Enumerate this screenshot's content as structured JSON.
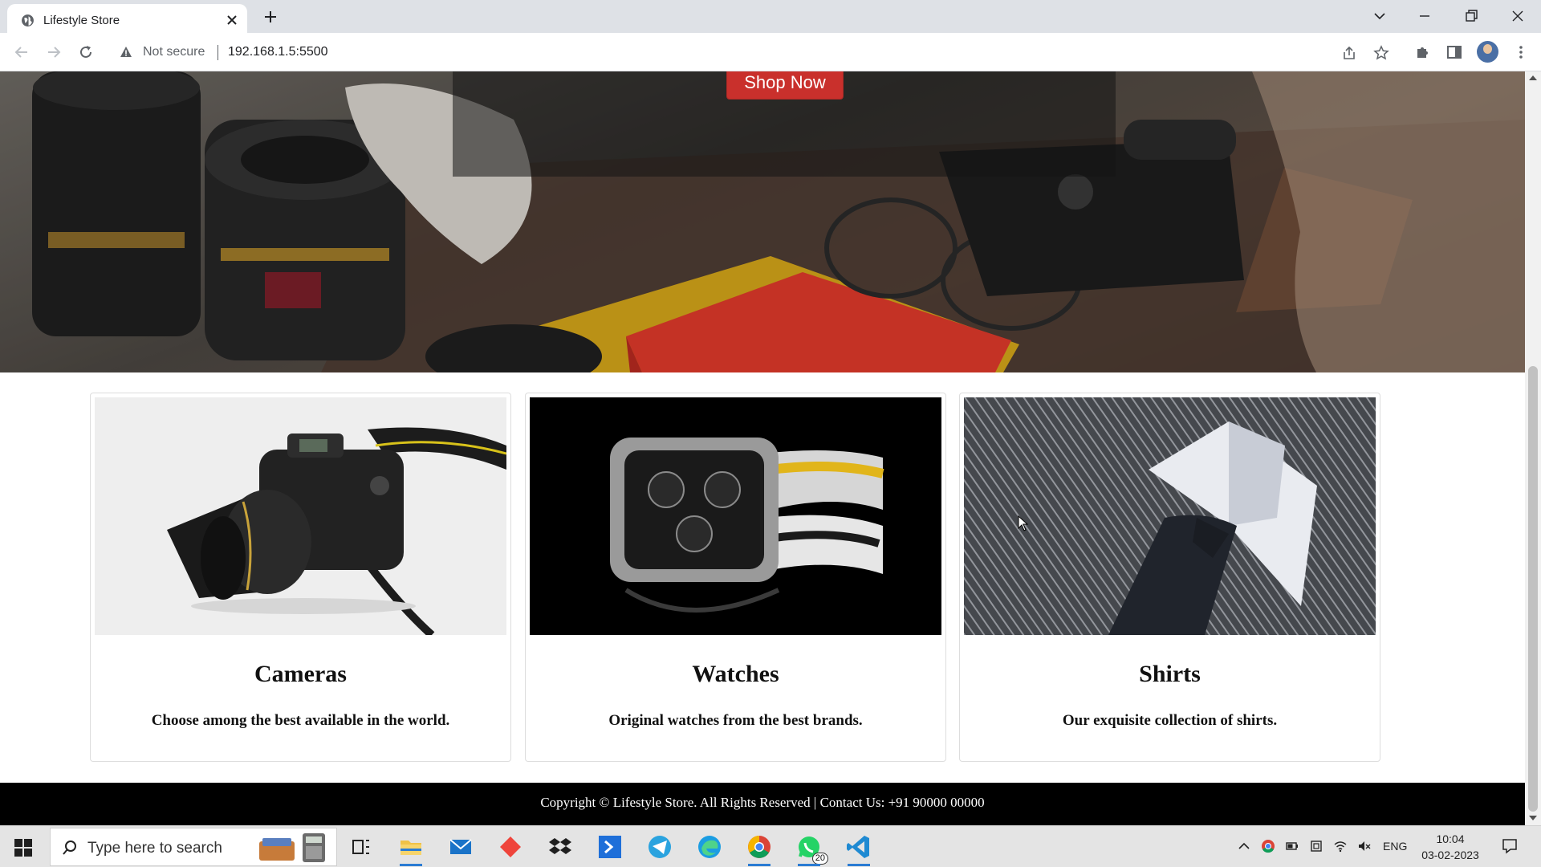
{
  "browser": {
    "tab_title": "Lifestyle Store",
    "security_label": "Not secure",
    "url": "192.168.1.5:5500"
  },
  "hero": {
    "button_label": "Shop Now"
  },
  "cards": [
    {
      "title": "Cameras",
      "text": "Choose among the best available in the world.",
      "image_icon": "camera-photo"
    },
    {
      "title": "Watches",
      "text": "Original watches from the best brands.",
      "image_icon": "watch-photo"
    },
    {
      "title": "Shirts",
      "text": "Our exquisite collection of shirts.",
      "image_icon": "shirt-photo"
    }
  ],
  "footer": {
    "text": "Copyright © Lifestyle Store. All Rights Reserved | Contact Us: +91 90000 00000"
  },
  "taskbar": {
    "search_placeholder": "Type here to search",
    "whatsapp_badge": "20",
    "language": "ENG",
    "time": "10:04",
    "date": "03-02-2023"
  },
  "colors": {
    "shop_button": "#c9302c",
    "footer_bg": "#000000",
    "tabbar_bg": "#dee1e6"
  }
}
